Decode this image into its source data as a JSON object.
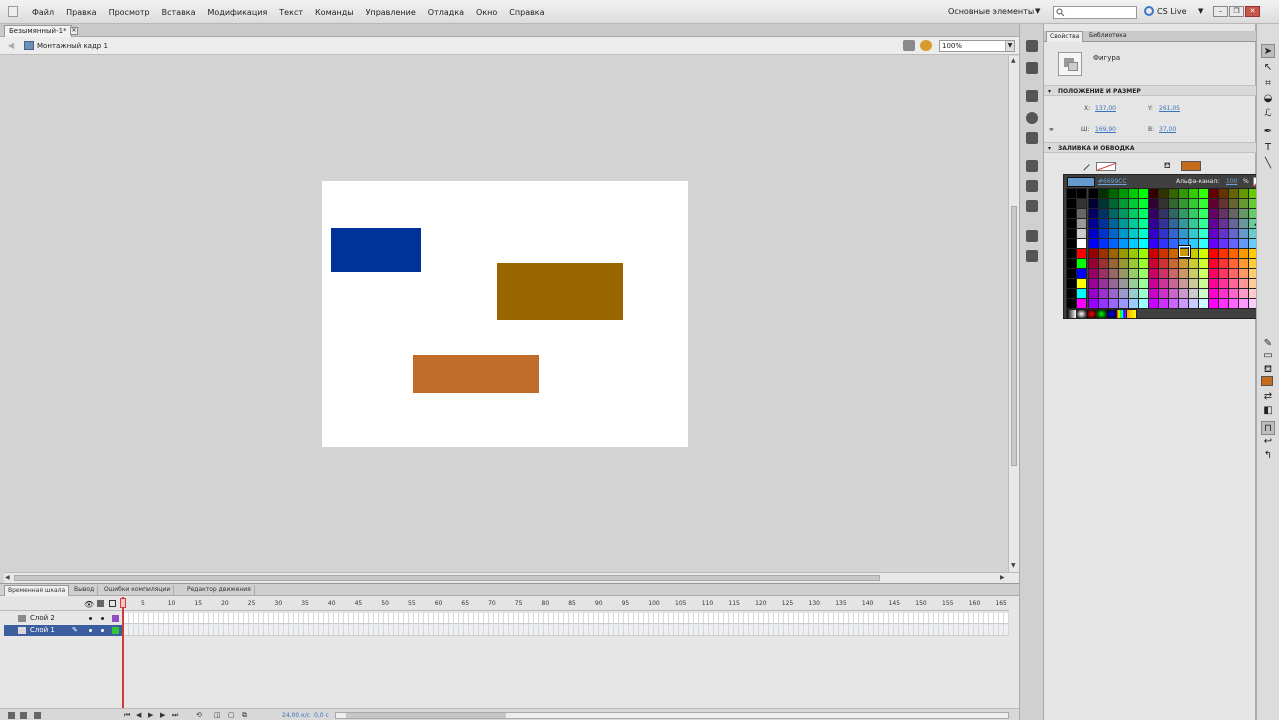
{
  "menu": {
    "items": [
      "Файл",
      "Правка",
      "Просмотр",
      "Вставка",
      "Модификация",
      "Текст",
      "Команды",
      "Управление",
      "Отладка",
      "Окно",
      "Справка"
    ],
    "workspace": "Основные элементы",
    "cs_live": "CS Live"
  },
  "document": {
    "tab": "Безымянный-1*",
    "scene": "Монтажный кадр 1",
    "zoom": "100%"
  },
  "stage": {
    "background": "#FFFFFF",
    "shapes": [
      {
        "name": "blue-rectangle",
        "color": "#003399"
      },
      {
        "name": "brown-rectangle",
        "color": "#996600"
      },
      {
        "name": "orange-rectangle",
        "color": "#C06C2A"
      }
    ]
  },
  "timeline": {
    "tabs": [
      "Временная шкала",
      "Вывод",
      "Ошибки компиляции",
      "Редактор движения"
    ],
    "frame_numbers": [
      "5",
      "10",
      "15",
      "20",
      "25",
      "30",
      "35",
      "40",
      "45",
      "50",
      "55",
      "60",
      "65",
      "70",
      "75",
      "80",
      "85",
      "90",
      "95",
      "100",
      "105",
      "110",
      "115",
      "120",
      "125",
      "130",
      "135",
      "140",
      "145",
      "150",
      "155",
      "160",
      "165"
    ],
    "layers": [
      {
        "name": "Слой 2",
        "color": "#8e4fbf",
        "selected": false
      },
      {
        "name": "Слой 1",
        "color": "#37c437",
        "selected": true
      }
    ],
    "fps": "24,00 к/с",
    "time": "0,0 с"
  },
  "properties": {
    "tabs": [
      "Свойства",
      "Библиотека"
    ],
    "object_type": "Фигура",
    "position_section": "ПОЛОЖЕНИЕ И РАЗМЕР",
    "x_label": "X:",
    "x_value": "137,00",
    "y_label": "Y:",
    "y_value": "261,05",
    "w_label": "Ш:",
    "w_value": "169,90",
    "h_label": "В:",
    "h_value": "37,00",
    "fill_section": "ЗАЛИВКА И ОБВОДКА",
    "fill_color": "#C76B1C"
  },
  "color_picker": {
    "hex": "#6699CC",
    "swatch_color": "#6699CC",
    "alpha_label": "Альфа-канал:",
    "alpha_value": "100",
    "percent": "%"
  }
}
